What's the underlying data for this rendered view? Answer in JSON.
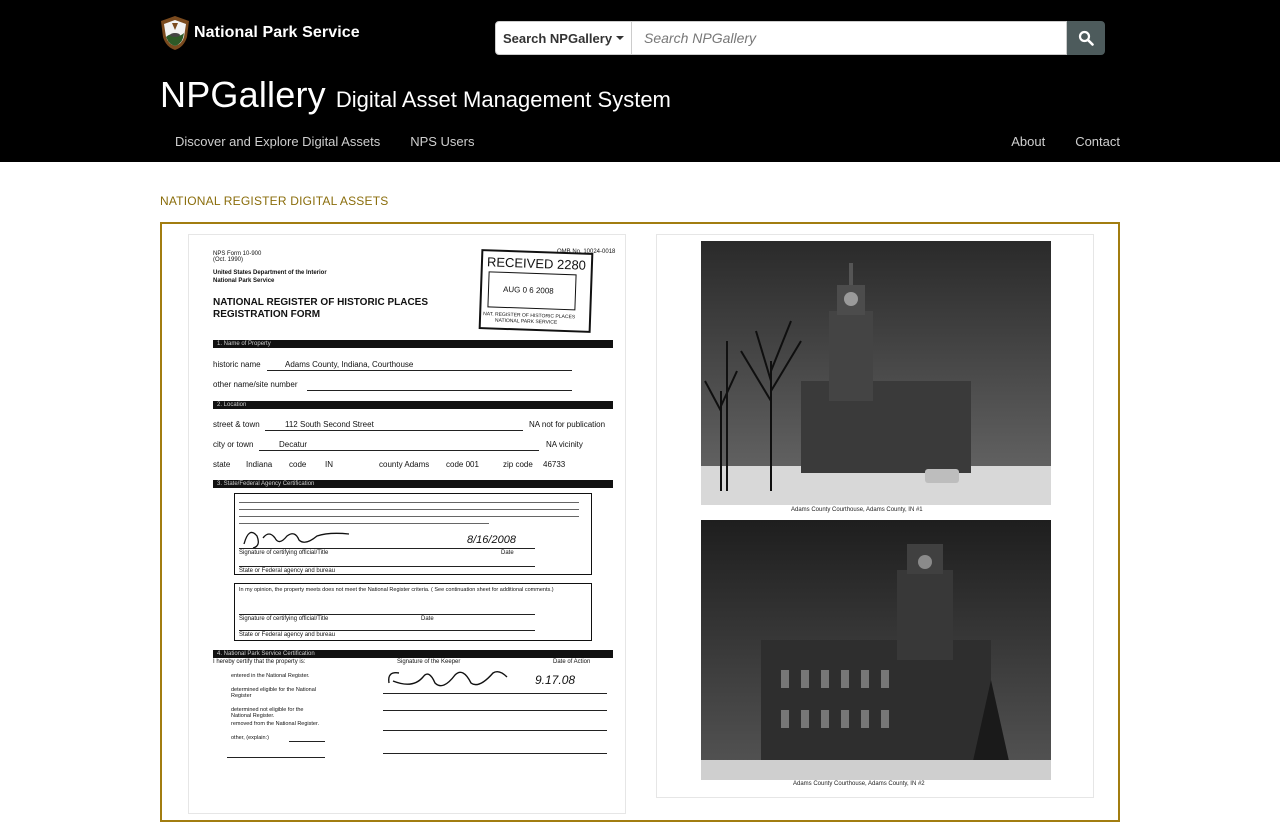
{
  "header": {
    "brand_name": "National Park Service",
    "search_scope_label": "Search NPGallery",
    "search_placeholder": "Search NPGallery",
    "title_main": "NPGallery",
    "title_sub": "Digital Asset Management System",
    "nav_left": [
      {
        "label": "Discover and Explore Digital Assets"
      },
      {
        "label": "NPS Users"
      }
    ],
    "nav_right": [
      {
        "label": "About"
      },
      {
        "label": "Contact"
      }
    ]
  },
  "main": {
    "section_label": "NATIONAL REGISTER DIGITAL ASSETS",
    "document": {
      "form_no": "NPS Form 10-900",
      "form_date": "(Oct. 1990)",
      "omb_no": "OMB No. 10024-0018",
      "dept": "United States Department of the Interior",
      "agency": "National Park Service",
      "form_title_1": "NATIONAL REGISTER OF HISTORIC PLACES",
      "form_title_2": "REGISTRATION FORM",
      "stamp_received": "RECEIVED 2280",
      "stamp_date": "AUG 0 6 2008",
      "stamp_footer_1": "NAT. REGISTER OF HISTORIC PLACES",
      "stamp_footer_2": "NATIONAL PARK SERVICE",
      "section_1": "1. Name of Property",
      "historic_name_label": "historic name",
      "historic_name": "Adams County, Indiana, Courthouse",
      "other_name_label": "other name/site number",
      "section_2": "2. Location",
      "street_label": "street & town",
      "street": "112 South Second Street",
      "not_for_pub": "NA   not for publication",
      "city_label": "city or town",
      "city": "Decatur",
      "vicinity": "NA    vicinity",
      "state_label": "state",
      "state": "Indiana",
      "code_label": "code",
      "state_code": "IN",
      "county_label": "county Adams",
      "county_code": "code 001",
      "zip_label": "zip code",
      "zip": "46733",
      "section_3": "3. State/Federal Agency Certification",
      "signature_label": "Signature of certifying official/Title",
      "date_label": "Date",
      "cert_date": "8/16/2008",
      "agency_label": "State or Federal agency and bureau",
      "opinion_text": "In my opinion, the property  meets  does not meet the National Register criteria. ( See continuation sheet for additional comments.)",
      "section_4": "4. National Park Service Certification",
      "certify_text": "I hereby certify that the property is:",
      "keeper_label": "Signature of the Keeper",
      "action_date_label": "Date of Action",
      "action_date": "9.17.08",
      "option_1": "entered in the National Register.",
      "option_2": "determined eligible for the National Register",
      "option_3": "determined not eligible for the National Register.",
      "option_4": "removed from the National Register.",
      "option_5": "other, (explain:)"
    },
    "photos": {
      "caption_1": "Adams County Courthouse, Adams County, IN #1",
      "caption_2": "Adams County Courthouse, Adams County, IN #2"
    }
  }
}
